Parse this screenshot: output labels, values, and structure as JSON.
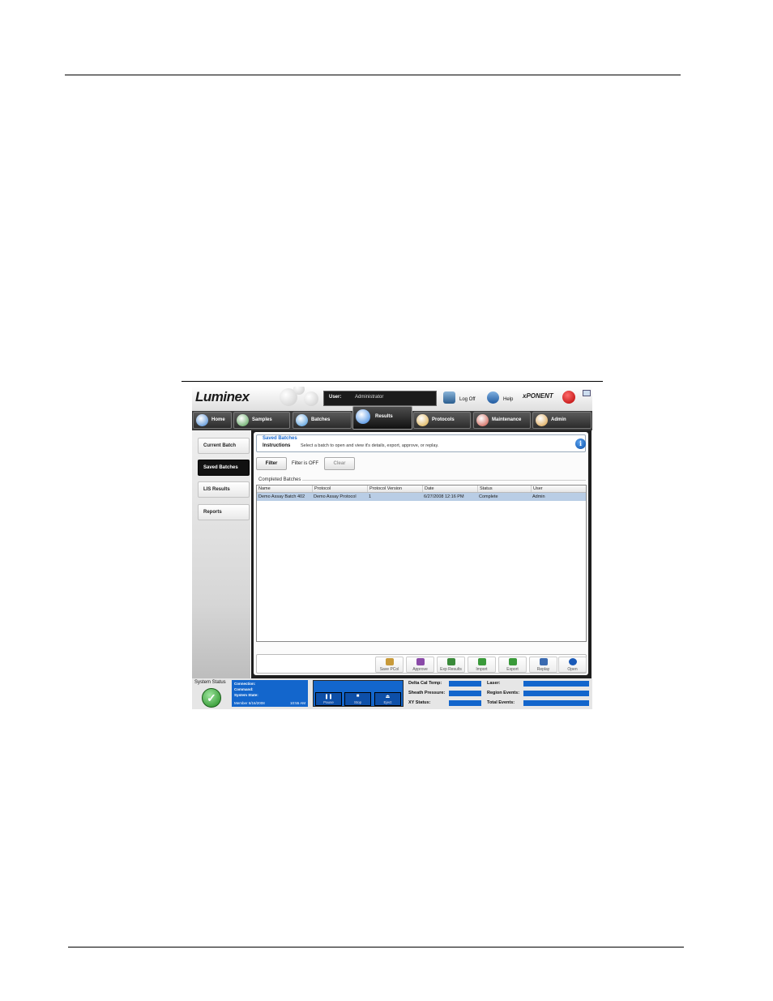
{
  "app": {
    "brand": "Luminex",
    "product": "xPONENT",
    "user_label": "User:",
    "user_value": "Administrator",
    "logoff_label": "Log Off",
    "help_label": "Help"
  },
  "nav": {
    "tabs": [
      {
        "label": "Home",
        "icon": "home-icon",
        "color": "#3a7fd0"
      },
      {
        "label": "Samples",
        "icon": "samples-icon",
        "color": "#4a9b4a"
      },
      {
        "label": "Batches",
        "icon": "batches-icon",
        "color": "#3b8fd8"
      },
      {
        "label": "Results",
        "icon": "results-icon",
        "color": "#2f7fe0",
        "active": true
      },
      {
        "label": "Protocols",
        "icon": "protocols-icon",
        "color": "#d8a63b"
      },
      {
        "label": "Maintenance",
        "icon": "maintenance-icon",
        "color": "#c84a3b"
      },
      {
        "label": "Admin",
        "icon": "admin-icon",
        "color": "#d89a3b"
      }
    ]
  },
  "sidebar": {
    "items": [
      {
        "label": "Current Batch"
      },
      {
        "label": "Saved Batches",
        "active": true
      },
      {
        "label": "LIS Results"
      },
      {
        "label": "Reports"
      }
    ]
  },
  "instructions": {
    "title": "Saved Batches",
    "label": "Instructions",
    "text": "Select a batch to open and view it's details, export, approve, or replay."
  },
  "filter": {
    "button": "Filter",
    "state": "Filter is OFF",
    "clear": "Clear"
  },
  "completed": {
    "label": "Completed Batches",
    "columns": [
      "Name",
      "Protocol",
      "Protocol Version",
      "Date",
      "Status",
      "User"
    ],
    "rows": [
      [
        "Demo Assay Batch 402",
        "Demo Assay Protocol",
        "1",
        "6/27/2008 12:16 PM",
        "Complete",
        "Admin"
      ]
    ]
  },
  "actions": [
    {
      "label": "Save PCol",
      "icon": "save-icon",
      "color": "#c89a3a"
    },
    {
      "label": "Approve",
      "icon": "approve-icon",
      "color": "#8a4aa8"
    },
    {
      "label": "Exp Results",
      "icon": "export-results-icon",
      "color": "#3a8a3a"
    },
    {
      "label": "Import",
      "icon": "import-icon",
      "color": "#3a9a3a"
    },
    {
      "label": "Export",
      "icon": "export-icon",
      "color": "#3a9a3a"
    },
    {
      "label": "Replay",
      "icon": "replay-icon",
      "color": "#3a6ab0"
    },
    {
      "label": "Open",
      "icon": "open-icon",
      "color": "#1a5ab8"
    }
  ],
  "status_bar": {
    "system_status": "System Status",
    "connection": "Connection:",
    "command": "Command:",
    "system_state": "System State:",
    "user_date": "Member 6/16/2008",
    "time": "10:55 AM",
    "run_buttons": [
      {
        "label": "Pause",
        "glyph": "❚❚"
      },
      {
        "label": "Stop",
        "glyph": "■"
      },
      {
        "label": "Eject",
        "glyph": "⏏"
      }
    ],
    "fields": [
      "Delta Cal Temp:",
      "Sheath Pressure:",
      "XY Status:",
      "Laser:",
      "Region Events:",
      "Total Events:"
    ]
  }
}
